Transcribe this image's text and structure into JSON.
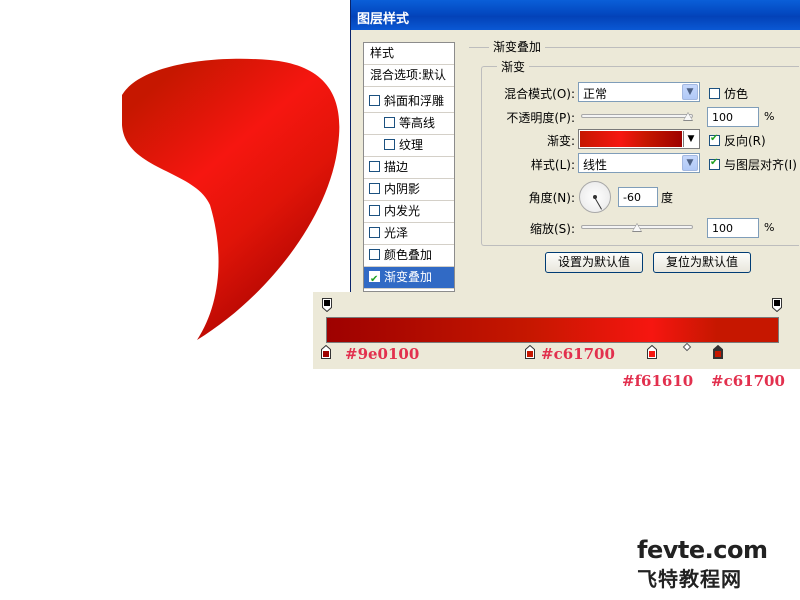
{
  "dialog": {
    "title": "图层样式",
    "left_panel": {
      "items": [
        {
          "label": "样式",
          "type": "header"
        },
        {
          "label": "混合选项:默认",
          "type": "header"
        },
        {
          "label": "斜面和浮雕",
          "type": "check",
          "checked": false
        },
        {
          "label": "等高线",
          "type": "sub",
          "checked": false
        },
        {
          "label": "纹理",
          "type": "sub",
          "checked": false
        },
        {
          "label": "描边",
          "type": "check",
          "checked": false
        },
        {
          "label": "内阴影",
          "type": "check",
          "checked": false
        },
        {
          "label": "内发光",
          "type": "check",
          "checked": false
        },
        {
          "label": "光泽",
          "type": "check",
          "checked": false
        },
        {
          "label": "颜色叠加",
          "type": "check",
          "checked": false
        },
        {
          "label": "渐变叠加",
          "type": "check",
          "checked": true,
          "selected": true
        }
      ]
    },
    "section_title": "渐变叠加",
    "group_title": "渐变",
    "blend_mode": {
      "label": "混合模式(O):",
      "value": "正常"
    },
    "dither": {
      "label": "仿色",
      "checked": false
    },
    "opacity": {
      "label": "不透明度(P):",
      "value": "100",
      "unit": "%",
      "level": 1.0
    },
    "gradient": {
      "label": "渐变:"
    },
    "reverse": {
      "label": "反向(R)",
      "checked": true
    },
    "style": {
      "label": "样式(L):",
      "value": "线性"
    },
    "align_with_layer": {
      "label": "与图层对齐(I)",
      "checked": true
    },
    "angle": {
      "label": "角度(N):",
      "value": "-60",
      "unit": "度",
      "degrees": -60
    },
    "scale": {
      "label": "缩放(S):",
      "value": "100",
      "unit": "%",
      "level": 0.5
    },
    "btn_make_default": "设置为默认值",
    "btn_reset_default": "复位为默认值"
  },
  "gradient_editor": {
    "stops": [
      {
        "color": "#9e0100",
        "position": 0.0,
        "label": "#9e0100"
      },
      {
        "color": "#c61700",
        "position": 0.45,
        "label": "#c61700"
      },
      {
        "color": "#f61610",
        "position": 0.72,
        "label": "#f61610"
      },
      {
        "color": "#c61700",
        "position": 0.865,
        "label": "#c61700"
      }
    ],
    "label_color": "#e2304e"
  },
  "shape": {
    "colors": {
      "dark": "#9e0100",
      "mid": "#c61700",
      "bright": "#f61610"
    }
  },
  "watermark": {
    "line1": "fevte.com",
    "line2": "飞特教程网"
  }
}
